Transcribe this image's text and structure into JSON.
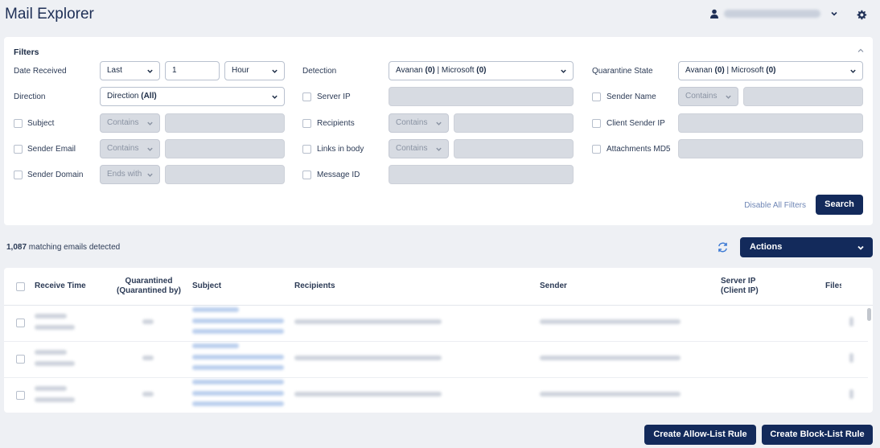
{
  "app": {
    "title": "Mail Explorer"
  },
  "user": {
    "email": ""
  },
  "filters": {
    "title": "Filters",
    "date_received": {
      "label": "Date Received",
      "mode": "Last",
      "amount": "1",
      "unit": "Hour"
    },
    "detection": {
      "label": "Detection",
      "value_a": "Avanan ",
      "count_a": "(0)",
      "sep": " | ",
      "value_b": "Microsoft ",
      "count_b": "(0)"
    },
    "quarantine_state": {
      "label": "Quarantine State",
      "value_a": "Avanan ",
      "count_a": "(0)",
      "sep": " | ",
      "value_b": "Microsoft ",
      "count_b": "(0)"
    },
    "direction": {
      "label": "Direction",
      "value": "Direction ",
      "value_bold": "(All)"
    },
    "server_ip": {
      "label": "Server IP"
    },
    "sender_name": {
      "label": "Sender Name",
      "op": "Contains"
    },
    "subject": {
      "label": "Subject",
      "op": "Contains"
    },
    "recipients": {
      "label": "Recipients",
      "op": "Contains"
    },
    "client_sender_ip": {
      "label": "Client Sender IP"
    },
    "sender_email": {
      "label": "Sender Email",
      "op": "Contains"
    },
    "links_in_body": {
      "label": "Links in body",
      "op": "Contains"
    },
    "attachments_md5": {
      "label": "Attachments MD5"
    },
    "sender_domain": {
      "label": "Sender Domain",
      "op": "Ends with"
    },
    "message_id": {
      "label": "Message ID"
    },
    "disable_all": "Disable All Filters",
    "search": "Search"
  },
  "results": {
    "count": "1,087",
    "count_suffix": " matching emails detected",
    "actions": "Actions"
  },
  "table": {
    "headers": {
      "receive_time": "Receive Time",
      "quarantined": "Quarantined",
      "quarantined_by": "(Quarantined by)",
      "subject": "Subject",
      "recipients": "Recipients",
      "sender": "Sender",
      "server_ip": "Server IP",
      "client_ip": "(Client IP)",
      "files": "Files"
    }
  },
  "footer": {
    "allow_rule": "Create Allow-List Rule",
    "block_rule": "Create Block-List Rule"
  }
}
